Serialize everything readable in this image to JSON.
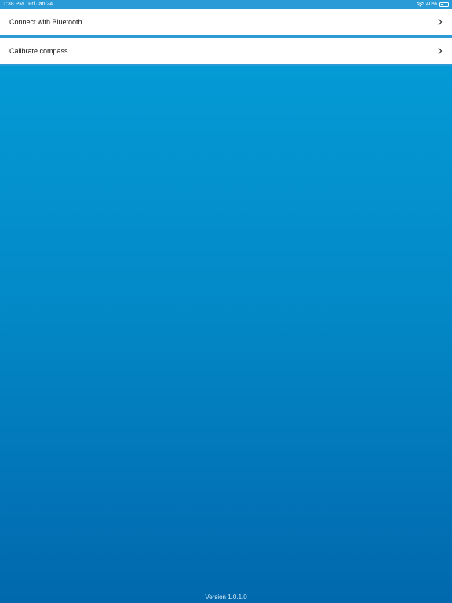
{
  "status_bar": {
    "time": "1:38 PM",
    "date": "Fri Jan 24",
    "wifi_icon": "wifi-icon",
    "battery_percent_text": "40%",
    "battery_level": 0.4,
    "battery_icon": "battery-icon"
  },
  "menu": {
    "items": [
      {
        "label": "Connect with Bluetooth",
        "icon": "chevron-right-icon"
      },
      {
        "label": "Calibrate compass",
        "icon": "chevron-right-icon"
      }
    ]
  },
  "footer": {
    "version": "Version 1.0.1.0"
  },
  "colors": {
    "background_top": "#049fd9",
    "background_bottom": "#0168ad",
    "menu_background": "#ffffff",
    "separator": "#2a9bd6",
    "status_bar": "#2a9bd6"
  }
}
